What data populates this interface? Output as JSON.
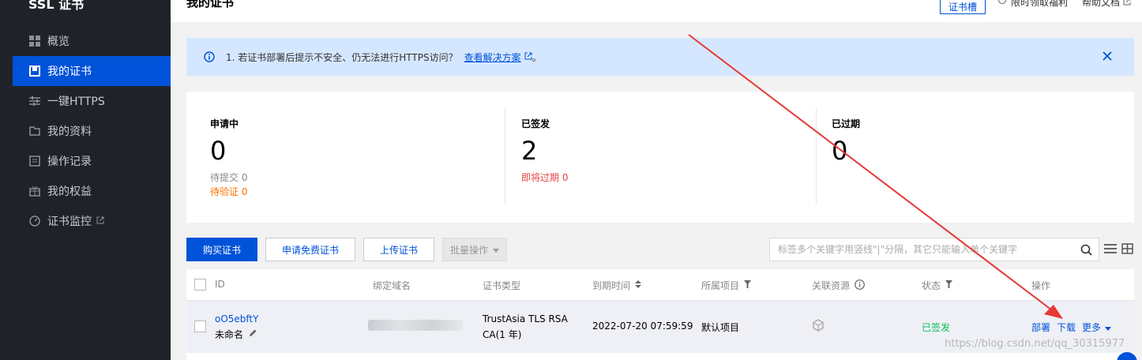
{
  "sidebar": {
    "brand": "SSL 证书",
    "items": [
      {
        "label": "概览",
        "icon": "grid-icon"
      },
      {
        "label": "我的证书",
        "icon": "certificate-icon"
      },
      {
        "label": "一键HTTPS",
        "icon": "sliders-icon"
      },
      {
        "label": "我的资料",
        "icon": "folder-icon"
      },
      {
        "label": "操作记录",
        "icon": "log-icon"
      },
      {
        "label": "我的权益",
        "icon": "gift-icon"
      },
      {
        "label": "证书监控",
        "icon": "monitor-icon"
      }
    ]
  },
  "header": {
    "title": "我的证书",
    "button_label": "证书槽",
    "link1": "限时领取福利",
    "link2": "帮助文档"
  },
  "notice": {
    "text": "1. 若证书部署后提示不安全、仍无法进行HTTPS访问？",
    "link": "查看解决方案",
    "suffix": "。"
  },
  "stats": [
    {
      "title": "申请中",
      "value": "0",
      "sub1": "待提交 0",
      "sub2": "待验证 0"
    },
    {
      "title": "已签发",
      "value": "2",
      "sub1": "即将过期 0"
    },
    {
      "title": "已过期",
      "value": "0"
    }
  ],
  "toolbar": {
    "buy": "购买证书",
    "apply_free": "申请免费证书",
    "upload": "上传证书",
    "batch": "批量操作",
    "search_placeholder": "标签多个关键字用竖线\"|\"分隔，其它只能输入单个关键字"
  },
  "table": {
    "headers": [
      "ID",
      "绑定域名",
      "证书类型",
      "到期时间",
      "所属项目",
      "关联资源",
      "状态",
      "操作"
    ],
    "row": {
      "id": "oO5ebftY",
      "name": "未命名",
      "cert_type_line1": "TrustAsia TLS RSA",
      "cert_type_line2": "CA(1 年)",
      "expiry": "2022-07-20 07:59:59",
      "project": "默认项目",
      "status": "已签发",
      "actions": [
        "部署",
        "下载",
        "更多"
      ]
    }
  },
  "watermark": "https://blog.csdn.net/qq_30315977",
  "colors": {
    "primary": "#0052d9",
    "sidebar_bg": "#1f2329",
    "success": "#0abf5b",
    "warning": "#ff7200",
    "danger": "#e54545",
    "annotation_arrow": "#e53935"
  }
}
